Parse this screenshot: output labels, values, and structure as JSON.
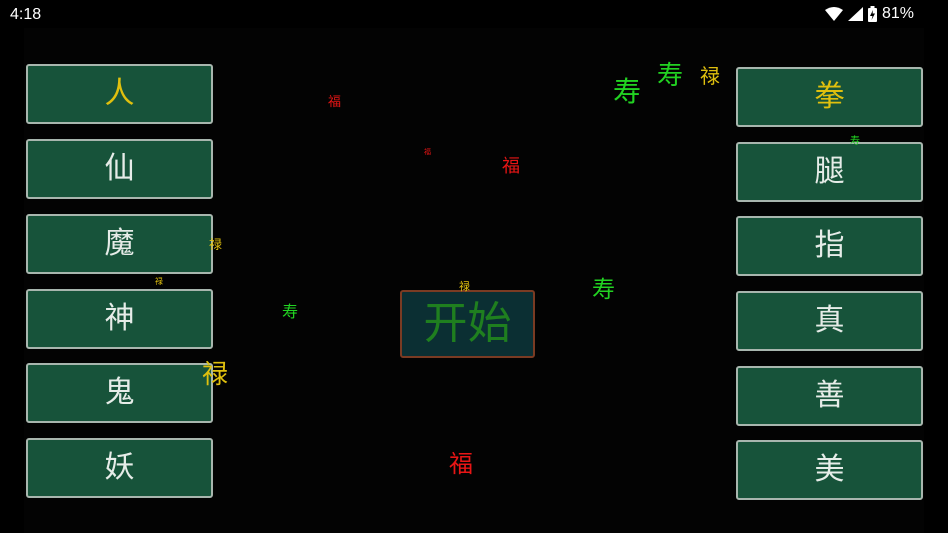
{
  "status_bar": {
    "time": "4:18",
    "battery": "81%",
    "icons": [
      "wifi-icon",
      "signal-icon",
      "battery-charging-icon"
    ]
  },
  "left_buttons": [
    {
      "label": "人",
      "color": "#e0c00e"
    },
    {
      "label": "仙",
      "color": "#e6ece8"
    },
    {
      "label": "魔",
      "color": "#e6ece8"
    },
    {
      "label": "神",
      "color": "#e6ece8"
    },
    {
      "label": "鬼",
      "color": "#e6ece8"
    },
    {
      "label": "妖",
      "color": "#e6ece8"
    }
  ],
  "right_buttons": [
    {
      "label": "拳",
      "color": "#e0c00e"
    },
    {
      "label": "腿",
      "color": "#e6ece8"
    },
    {
      "label": "指",
      "color": "#e6ece8"
    },
    {
      "label": "真",
      "color": "#e6ece8"
    },
    {
      "label": "善",
      "color": "#e6ece8"
    },
    {
      "label": "美",
      "color": "#e6ece8"
    }
  ],
  "start_button": {
    "label": "开始"
  },
  "floating_chars": {
    "fu_1": "福",
    "fu_2": "福",
    "fu_3": "福",
    "fu_4": "福",
    "shou_1": "寿",
    "shou_2": "寿",
    "shou_3": "寿",
    "shou_4": "寿",
    "shou_5": "寿",
    "lu_1": "禄",
    "lu_2": "禄",
    "lu_3": "禄",
    "lu_4": "禄",
    "lu_5": "禄"
  },
  "colors": {
    "background": "#000000",
    "tile_fill": "#17533a",
    "tile_border": "#a8b6ae",
    "start_fill": "#0b2f33",
    "start_border": "#7a3b23",
    "start_text": "#1f7f1f",
    "fu": "#e81515",
    "shou": "#22d322",
    "lu": "#e0c00e"
  }
}
